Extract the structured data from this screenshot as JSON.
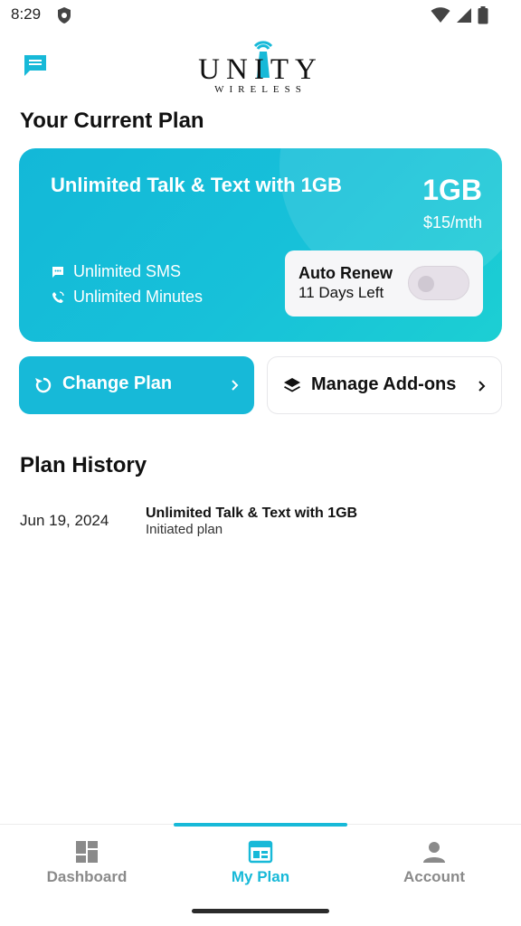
{
  "status_bar": {
    "time": "8:29"
  },
  "header": {
    "logo_text": "UNITY",
    "logo_subtext": "WIRELESS"
  },
  "current_plan": {
    "section_title": "Your Current Plan",
    "plan_name": "Unlimited Talk & Text with 1GB",
    "data_amount": "1GB",
    "price": "$15/mth",
    "features": [
      "Unlimited SMS",
      "Unlimited Minutes"
    ],
    "auto_renew": {
      "label": "Auto Renew",
      "days_left": "11 Days Left",
      "enabled": false
    }
  },
  "actions": {
    "change_plan": "Change Plan",
    "manage_addons": "Manage Add-ons"
  },
  "history": {
    "section_title": "Plan History",
    "entries": [
      {
        "date": "Jun 19, 2024",
        "plan": "Unlimited Talk & Text with 1GB",
        "note": "Initiated plan"
      }
    ]
  },
  "bottom_nav": {
    "items": [
      {
        "label": "Dashboard",
        "icon": "dashboard-icon",
        "active": false
      },
      {
        "label": "My Plan",
        "icon": "my-plan-icon",
        "active": true
      },
      {
        "label": "Account",
        "icon": "account-icon",
        "active": false
      }
    ]
  },
  "colors": {
    "accent": "#17b9d8",
    "inactive": "#8a8a8a",
    "text": "#111111"
  }
}
